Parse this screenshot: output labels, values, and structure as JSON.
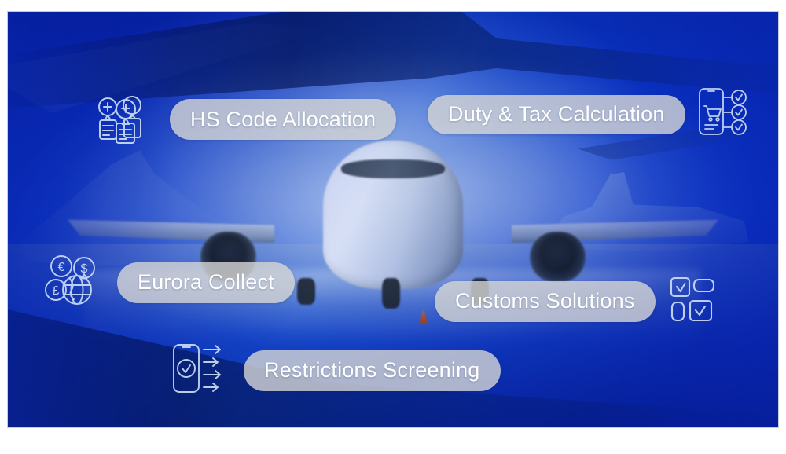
{
  "image": {
    "kind": "marketing-hero-image",
    "subject": "commercial-airliner-on-tarmac",
    "overlay_tint": "#0b41cf",
    "pill_background": "#d6d6d4",
    "pill_text_color": "#ffffff",
    "icon_stroke_color": "#cfe0f7"
  },
  "features": [
    {
      "id": "hs-code-allocation",
      "label": "HS Code Allocation",
      "icon": "document-tags-plus-icon",
      "icon_side": "left"
    },
    {
      "id": "duty-tax-calculation",
      "label": "Duty & Tax Calculation",
      "icon": "phone-cart-checklist-icon",
      "icon_side": "right"
    },
    {
      "id": "eurora-collect",
      "label": "Eurora Collect",
      "icon": "currency-globe-icon",
      "icon_side": "left"
    },
    {
      "id": "customs-solutions",
      "label": "Customs Solutions",
      "icon": "checkbox-grid-icon",
      "icon_side": "right"
    },
    {
      "id": "restrictions-screening",
      "label": "Restrictions Screening",
      "icon": "phone-check-arrows-icon",
      "icon_side": "left"
    }
  ],
  "icon_glyphs": {
    "currency_symbols": [
      "€",
      "$",
      "£"
    ]
  }
}
